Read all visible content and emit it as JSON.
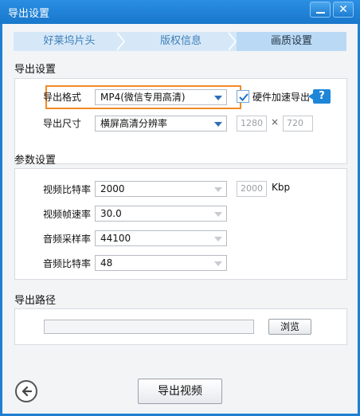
{
  "window": {
    "title": "导出设置",
    "minimize": "—",
    "close": "✕"
  },
  "steps": [
    "好莱坞片头",
    "版权信息",
    "画质设置"
  ],
  "export_settings": {
    "title": "导出设置",
    "format_label": "导出格式",
    "format_value": "MP4(微信专用高清)",
    "hw_accel_label": "硬件加速导出",
    "hw_accel_checked": true,
    "help": "?",
    "size_label": "导出尺寸",
    "size_value": "横屏高清分辨率",
    "width": "1280",
    "times": "×",
    "height": "720"
  },
  "params": {
    "title": "参数设置",
    "video_bitrate_label": "视频比特率",
    "video_bitrate_value": "2000",
    "video_bitrate_input": "2000",
    "video_bitrate_unit": "Kbp",
    "frame_rate_label": "视频帧速率",
    "frame_rate_value": "30.0",
    "sample_rate_label": "音频采样率",
    "sample_rate_value": "44100",
    "audio_bitrate_label": "音频比特率",
    "audio_bitrate_value": "48"
  },
  "path": {
    "title": "导出路径",
    "value": "",
    "browse": "浏览"
  },
  "footer": {
    "export_button": "导出视频"
  },
  "icons": {
    "back": "back-arrow-icon",
    "check": "check-icon",
    "help": "help-icon"
  },
  "colors": {
    "titlebar": "#1f7fd0",
    "highlight": "#f28a24",
    "accent": "#1e86d9"
  }
}
